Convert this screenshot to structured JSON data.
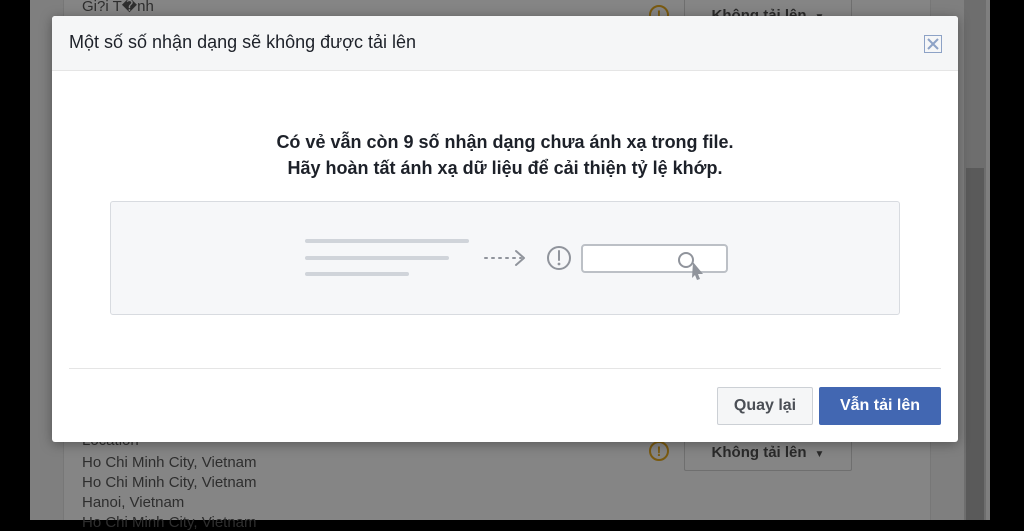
{
  "background": {
    "top_field_label": "Gi?i T�nh",
    "top_dropdown_label": "Không tải lên",
    "location_label": "Location",
    "location_values": [
      "Ho Chi Minh City, Vietnam",
      "Ho Chi Minh City, Vietnam",
      "Hanoi, Vietnam",
      "Ho Chi Minh City, Vietnam"
    ],
    "bottom_dropdown_label": "Không tải lên"
  },
  "modal": {
    "title": "Một số số nhận dạng sẽ không được tải lên",
    "message_line1": "Có vẻ vẫn còn 9 số nhận dạng chưa ánh xạ trong file.",
    "message_line2": "Hãy hoàn tất ánh xạ dữ liệu để cải thiện tỷ lệ khớp.",
    "back_label": "Quay lại",
    "upload_label": "Vẫn tải lên"
  },
  "colors": {
    "primary": "#4267b2",
    "header_bg": "#f5f6f7",
    "text": "#1d2129",
    "illustration_stroke": "#c7ccd4"
  },
  "icons": {
    "close": "close-icon",
    "warning": "warning-icon",
    "arrow": "dotted-arrow-icon",
    "cursor": "cursor-icon",
    "caret": "caret-down-icon"
  }
}
